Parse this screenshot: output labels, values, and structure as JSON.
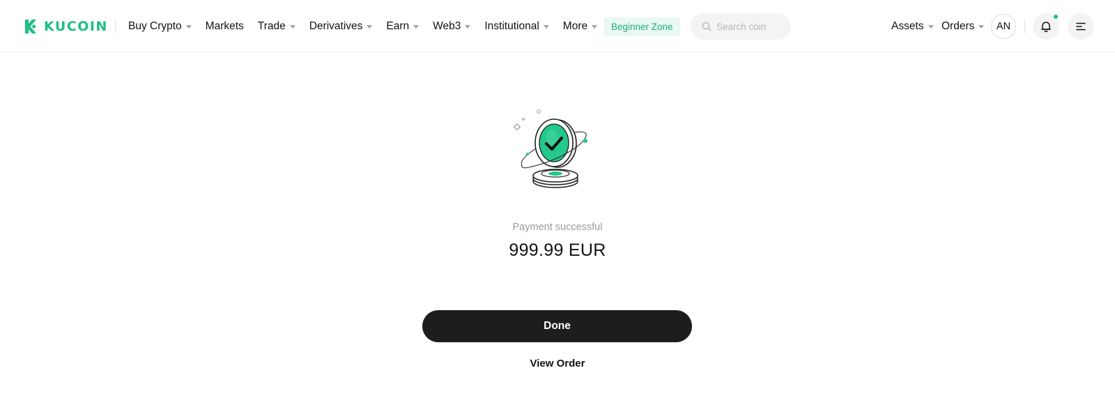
{
  "brand": {
    "name": "KUCOIN",
    "accent_color": "#1dbf84"
  },
  "nav": {
    "items": [
      {
        "label": "Buy Crypto",
        "dropdown": true
      },
      {
        "label": "Markets",
        "dropdown": false
      },
      {
        "label": "Trade",
        "dropdown": true
      },
      {
        "label": "Derivatives",
        "dropdown": true
      },
      {
        "label": "Earn",
        "dropdown": true
      },
      {
        "label": "Web3",
        "dropdown": true
      },
      {
        "label": "Institutional",
        "dropdown": true
      },
      {
        "label": "More",
        "dropdown": true
      }
    ],
    "beginner_zone": "Beginner Zone"
  },
  "search": {
    "placeholder": "Search coin",
    "icon": "search-icon"
  },
  "header_right": {
    "assets_label": "Assets",
    "orders_label": "Orders",
    "avatar_initials": "AN",
    "notification_icon": "bell-icon",
    "menu_icon": "menu-icon",
    "has_unread_notification": true
  },
  "main": {
    "illustration": "success-coin-check-icon",
    "status": "Payment successful",
    "amount": "999.99 EUR",
    "done_label": "Done",
    "view_order_label": "View Order"
  }
}
